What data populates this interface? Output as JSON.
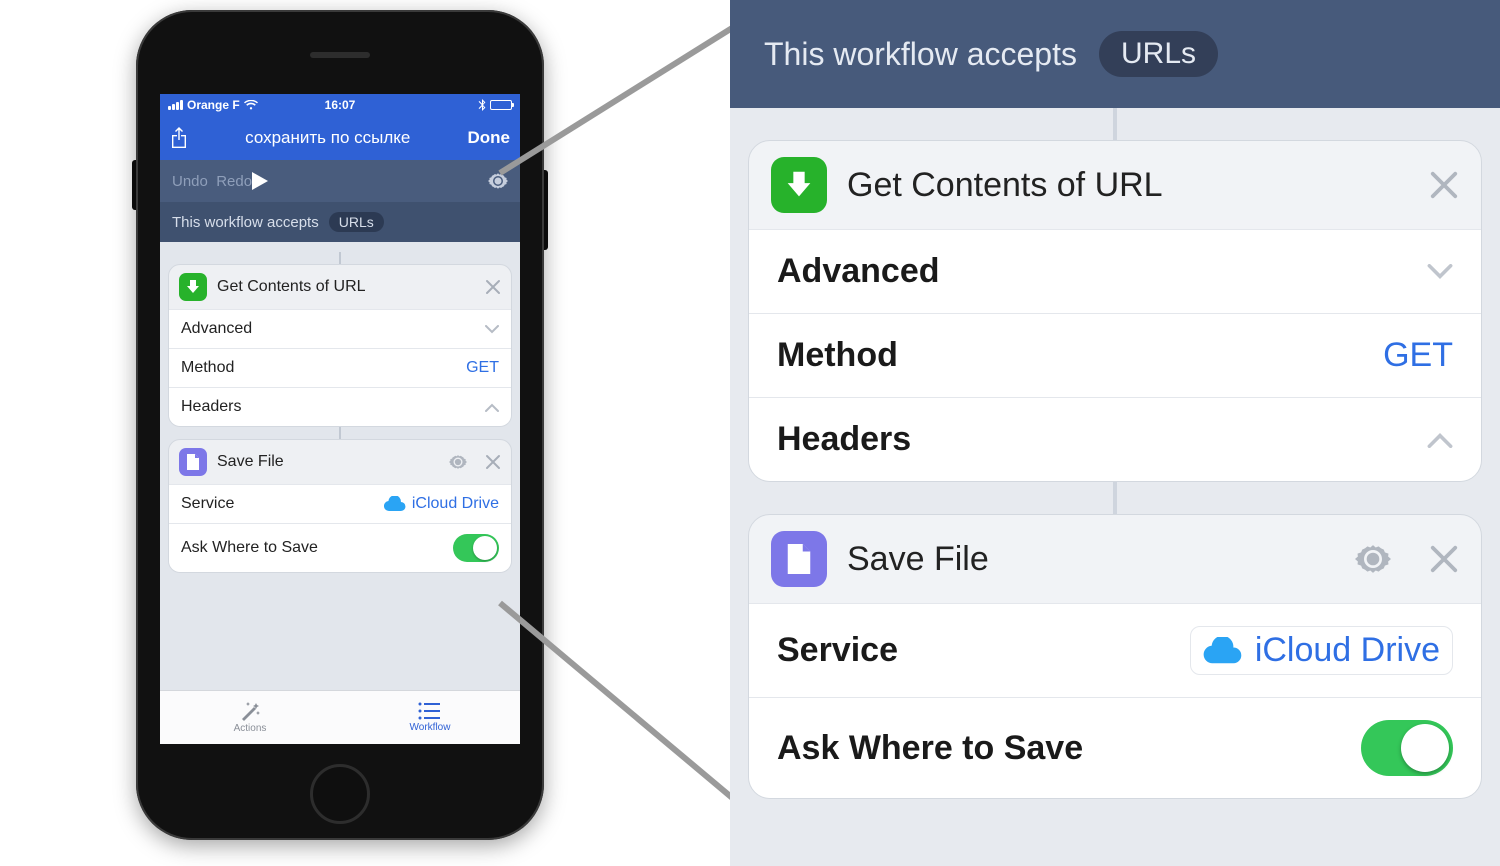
{
  "status": {
    "carrier": "Orange F",
    "time": "16:07"
  },
  "nav": {
    "title": "сохранить по ссылке",
    "done": "Done"
  },
  "toolbar": {
    "undo": "Undo",
    "redo": "Redo"
  },
  "accepts": {
    "label": "This workflow accepts",
    "type": "URLs"
  },
  "action1": {
    "title": "Get Contents of URL",
    "advanced": "Advanced",
    "method_label": "Method",
    "method_value": "GET",
    "headers": "Headers",
    "icon_color": "#27b22b"
  },
  "action2": {
    "title": "Save File",
    "service_label": "Service",
    "service_value": "iCloud Drive",
    "ask_label": "Ask Where to Save",
    "ask_value": true,
    "icon_color": "#7d77e8"
  },
  "tabs": {
    "actions": "Actions",
    "workflow": "Workflow"
  },
  "colors": {
    "nav_blue": "#2f61d5",
    "toolbar_blue": "#495c7d",
    "accepts_blue": "#3f516f",
    "link_blue": "#2f6fe4",
    "toggle_green": "#34c759"
  }
}
